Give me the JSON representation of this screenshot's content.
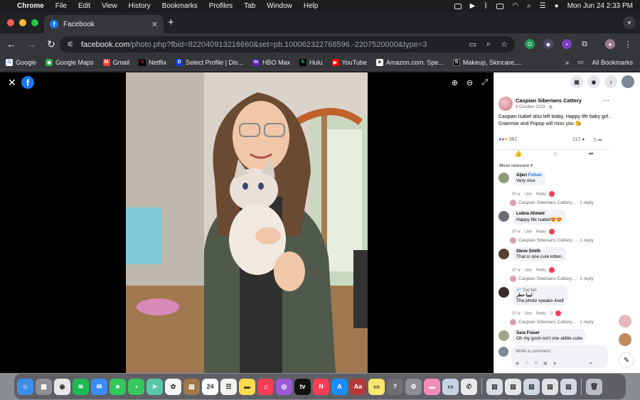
{
  "menubar": {
    "app": "Chrome",
    "items": [
      "File",
      "Edit",
      "View",
      "History",
      "Bookmarks",
      "Profiles",
      "Tab",
      "Window",
      "Help"
    ],
    "datetime": "Mon Jun 24  2:33 PM"
  },
  "tab": {
    "title": "Facebook"
  },
  "omnibox": {
    "host": "facebook.com",
    "path": "/photo.php?fbid=822040913216660&set=pb.100062322768596.-2207520000&type=3"
  },
  "bookmarks": {
    "items": [
      {
        "label": "Google",
        "icon": "google-icon",
        "color": "#ffffff"
      },
      {
        "label": "Google Maps",
        "icon": "maps-icon",
        "color": "#34a853"
      },
      {
        "label": "Gmail",
        "icon": "gmail-icon",
        "color": "#ea4335"
      },
      {
        "label": "Netflix",
        "icon": "netflix-icon",
        "color": "#e50914"
      },
      {
        "label": "Select Profile | Dis...",
        "icon": "disney-icon",
        "color": "#113ccf"
      },
      {
        "label": "HBO Max",
        "icon": "hbomax-icon",
        "color": "#5822b4"
      },
      {
        "label": "Hulu",
        "icon": "hulu-icon",
        "color": "#1ce783"
      },
      {
        "label": "YouTube",
        "icon": "youtube-icon",
        "color": "#ff0000"
      },
      {
        "label": "Amazon.com. Spe...",
        "icon": "amazon-icon",
        "color": "#ffffff"
      },
      {
        "label": "Makeup, Skincare,...",
        "icon": "sephora-icon",
        "color": "#000000"
      }
    ],
    "all_bookmarks": "All Bookmarks"
  },
  "post": {
    "author": "Caspian Siberians Cattery",
    "date": "8 October 2023 · ",
    "text": "Caspian Isabel also left today. Happy life baby girl. Grammie and Popop will miss you 😘",
    "reactions_count": "382",
    "comments_count": "112",
    "shares_count": "5",
    "filter_label": "Most relevant ▾"
  },
  "comments": [
    {
      "author": "Aljeri",
      "follow": "Follow",
      "text": "Very nice",
      "time": "37 w",
      "like": "Like",
      "reply": "Reply",
      "reply_summary": "Caspian Siberians Cattery... · 1 reply",
      "avatar_color": "#8c9a76"
    },
    {
      "author": "Lubna Ahmed",
      "text": "Happy life Isabel😍😍",
      "time": "37 w",
      "like": "Like",
      "reply": "Reply",
      "reply_summary": "Caspian Siberians Cattery... · 1 reply",
      "avatar_color": "#6d6a75"
    },
    {
      "author": "Steve Smith",
      "text": "That is one cute kitten.",
      "time": "37 w",
      "like": "Like",
      "reply": "Reply",
      "reply_summary": "Caspian Siberians Cattery... · 1 reply",
      "avatar_color": "#5a4030"
    },
    {
      "badge": "💎 Top fan",
      "author": "ليبيا حطر",
      "text": "The photo speaks itself",
      "time": "37 w",
      "like": "Like",
      "reply": "Reply",
      "reply_count": "2",
      "reply_summary": "Caspian Siberians Cattery... · 1 reply",
      "avatar_color": "#3b2a2a"
    },
    {
      "author": "Sara Fraser",
      "text": "Oh my gosh isn't she alittle cutie",
      "avatar_color": "#a3a38a"
    }
  ],
  "write_comment": "Write a comment...",
  "dock": [
    {
      "name": "finder-icon",
      "color": "#3d8ee6",
      "glyph": "☺"
    },
    {
      "name": "launchpad-icon",
      "color": "#8e8e93",
      "glyph": "▦"
    },
    {
      "name": "chrome-icon",
      "color": "#e8e8e8",
      "glyph": "◉"
    },
    {
      "name": "spotify-icon",
      "color": "#1db954",
      "glyph": "≋"
    },
    {
      "name": "mail-icon",
      "color": "#3a8df5",
      "glyph": "✉"
    },
    {
      "name": "facetime-icon",
      "color": "#34c759",
      "glyph": "■"
    },
    {
      "name": "messages-icon",
      "color": "#34c759",
      "glyph": "◖"
    },
    {
      "name": "maps-icon",
      "color": "#5ac8a8",
      "glyph": "➤"
    },
    {
      "name": "photos-icon",
      "color": "#f5f5f5",
      "glyph": "✿"
    },
    {
      "name": "notes-folder-icon",
      "color": "#a0784a",
      "glyph": "▤"
    },
    {
      "name": "calendar-icon",
      "color": "#ffffff",
      "glyph": "24"
    },
    {
      "name": "reminders-icon",
      "color": "#f2f2f2",
      "glyph": "☰"
    },
    {
      "name": "notes-icon",
      "color": "#fedb4e",
      "glyph": "▬"
    },
    {
      "name": "music-icon",
      "color": "#fa3c55",
      "glyph": "♫"
    },
    {
      "name": "podcasts-icon",
      "color": "#9b59d6",
      "glyph": "◎"
    },
    {
      "name": "appletv-icon",
      "color": "#111111",
      "glyph": "tv"
    },
    {
      "name": "news-icon",
      "color": "#fa3c55",
      "glyph": "N"
    },
    {
      "name": "appstore-icon",
      "color": "#1a8cff",
      "glyph": "A"
    },
    {
      "name": "dictionary-icon",
      "color": "#b33a3a",
      "glyph": "Aa"
    },
    {
      "name": "stickies-icon",
      "color": "#fce76c",
      "glyph": "▭"
    },
    {
      "name": "help-icon",
      "color": "#6e6e73",
      "glyph": "?"
    },
    {
      "name": "settings-icon",
      "color": "#8e8e93",
      "glyph": "⚙"
    },
    {
      "name": "cleaner-icon",
      "color": "#f28cb8",
      "glyph": "▬"
    },
    {
      "name": "preview-icon",
      "color": "#c7d3e3",
      "glyph": "▭"
    },
    {
      "name": "whatsapp-icon",
      "color": "#e9e9e9",
      "glyph": "✆"
    },
    {
      "name": "doc-thumb-1",
      "color": "#d8dde6",
      "glyph": "▤"
    },
    {
      "name": "doc-thumb-2",
      "color": "#e6e6e6",
      "glyph": "▤"
    },
    {
      "name": "doc-thumb-3",
      "color": "#cfd8e3",
      "glyph": "▤"
    },
    {
      "name": "doc-thumb-4",
      "color": "#e2e2e2",
      "glyph": "▤"
    },
    {
      "name": "doc-thumb-5",
      "color": "#d3dae4",
      "glyph": "▤"
    },
    {
      "name": "trash-icon",
      "color": "#b9bcc1",
      "glyph": "🗑"
    }
  ]
}
